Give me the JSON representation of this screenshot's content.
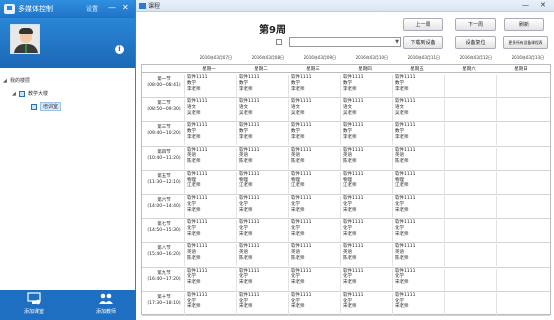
{
  "left_panel": {
    "app_title": "多媒体控制",
    "settings_label": "设置",
    "window_controls": [
      "—",
      "✕"
    ],
    "tree": [
      {
        "label": "我的楼层",
        "level": 0
      },
      {
        "label": "教学大楼",
        "level": 1
      },
      {
        "label": "培训室",
        "level": 2,
        "selected": true
      }
    ],
    "bottom_buttons": [
      "添加课室",
      "添加教师"
    ]
  },
  "main_window": {
    "title": "课程",
    "week_label": "第9周",
    "buttons": {
      "prev_week": "上一周",
      "next_week": "下一周",
      "refresh": "刷新",
      "download": "下载到设备",
      "reset": "设备复位",
      "set_all": "更多所有设备课程表"
    },
    "dates": [
      "2016年03月07日",
      "2016年03月08日",
      "2016年03月09日",
      "2016年03月10日",
      "2016年03月11日",
      "2016年03月12日",
      "2016年03月13日"
    ],
    "weekdays": [
      "星期一",
      "星期二",
      "星期三",
      "星期四",
      "星期五",
      "星期六",
      "星期日"
    ],
    "periods": [
      {
        "name": "第一节",
        "time": "(08:00~08:41)",
        "cells": [
          [
            "软件1111",
            "数学",
            "李老师"
          ],
          [
            "软件1111",
            "数学",
            "李老师"
          ],
          [
            "软件1111",
            "数学",
            "李老师"
          ],
          [
            "软件1111",
            "数学",
            "李老师"
          ],
          [
            "软件1111",
            "数学",
            "李老师"
          ]
        ]
      },
      {
        "name": "第二节",
        "time": "(08:50~09:30)",
        "cells": [
          [
            "软件1111",
            "语文",
            "吴老师"
          ],
          [
            "软件1111",
            "语文",
            "吴老师"
          ],
          [
            "软件1111",
            "语文",
            "吴老师"
          ],
          [
            "软件1111",
            "语文",
            "吴老师"
          ],
          [
            "软件1111",
            "语文",
            "吴老师"
          ]
        ]
      },
      {
        "name": "第三节",
        "time": "(09:40~10:20)",
        "cells": [
          [
            "软件1111",
            "数学",
            "李老师"
          ],
          [
            "软件1111",
            "数学",
            "李老师"
          ],
          [
            "软件1111",
            "数学",
            "李老师"
          ],
          [
            "软件1111",
            "数学",
            "李老师"
          ],
          [
            "软件1111",
            "数学",
            "李老师"
          ]
        ]
      },
      {
        "name": "第四节",
        "time": "(10:40~11:20)",
        "cells": [
          [
            "软件1111",
            "英语",
            "陈老师"
          ],
          [
            "软件1111",
            "英语",
            "陈老师"
          ],
          [
            "软件1111",
            "英语",
            "陈老师"
          ],
          [
            "软件1111",
            "英语",
            "陈老师"
          ],
          [
            "软件1111",
            "英语",
            "陈老师"
          ]
        ]
      },
      {
        "name": "第五节",
        "time": "(11:30~12:10)",
        "cells": [
          [
            "软件1111",
            "物理",
            "江老师"
          ],
          [
            "软件1111",
            "物理",
            "江老师"
          ],
          [
            "软件1111",
            "物理",
            "江老师"
          ],
          [
            "软件1111",
            "物理",
            "江老师"
          ],
          [
            "软件1111",
            "物理",
            "江老师"
          ]
        ]
      },
      {
        "name": "第六节",
        "time": "(14:00~14:40)",
        "cells": [
          [
            "软件1111",
            "化学",
            "宋老师"
          ],
          [
            "软件1111",
            "化学",
            "宋老师"
          ],
          [
            "软件1111",
            "化学",
            "宋老师"
          ],
          [
            "软件1111",
            "化学",
            "宋老师"
          ],
          [
            "软件1111",
            "化学",
            "宋老师"
          ]
        ]
      },
      {
        "name": "第七节",
        "time": "(14:50~15:30)",
        "cells": [
          [
            "软件1111",
            "化学",
            "宋老师"
          ],
          [
            "软件1111",
            "化学",
            "宋老师"
          ],
          [
            "软件1111",
            "化学",
            "宋老师"
          ],
          [
            "软件1111",
            "化学",
            "宋老师"
          ],
          [
            "软件1111",
            "化学",
            "宋老师"
          ]
        ]
      },
      {
        "name": "第八节",
        "time": "(15:40~16:20)",
        "cells": [
          [
            "软件1111",
            "英语",
            "陈老师"
          ],
          [
            "软件1111",
            "英语",
            "陈老师"
          ],
          [
            "软件1111",
            "英语",
            "陈老师"
          ],
          [
            "软件1111",
            "英语",
            "陈老师"
          ],
          [
            "软件1111",
            "英语",
            "陈老师"
          ]
        ]
      },
      {
        "name": "第九节",
        "time": "(16:40~17:20)",
        "cells": [
          [
            "软件1111",
            "化学",
            "宋老师"
          ],
          [
            "软件1111",
            "化学",
            "宋老师"
          ],
          [
            "软件1111",
            "化学",
            "宋老师"
          ],
          [
            "软件1111",
            "化学",
            "宋老师"
          ],
          [
            "软件1111",
            "化学",
            "宋老师"
          ]
        ]
      },
      {
        "name": "第十节",
        "time": "(17:30~18:10)",
        "cells": [
          [
            "软件1111",
            "化学",
            "宋老师"
          ],
          [
            "软件1111",
            "化学",
            "宋老师"
          ],
          [
            "软件1111",
            "化学",
            "宋老师"
          ],
          [
            "软件1111",
            "化学",
            "宋老师"
          ],
          [
            "软件1111",
            "化学",
            "宋老师"
          ]
        ]
      }
    ]
  }
}
